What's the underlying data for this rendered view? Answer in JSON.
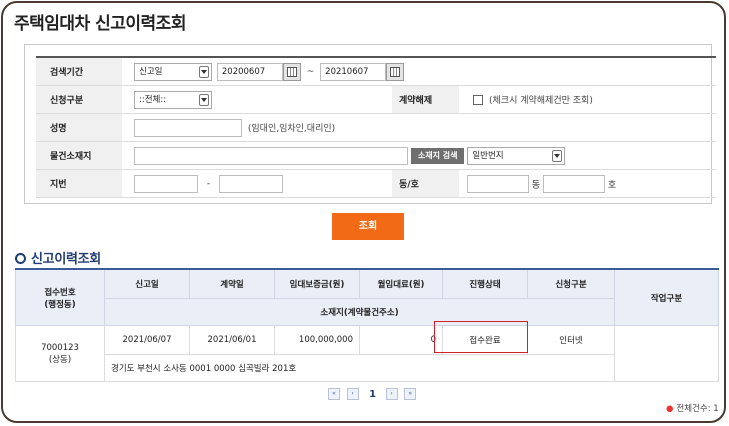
{
  "page_title": "주택임대차 신고이력조회",
  "search": {
    "period_label": "검색기간",
    "date_type_selected": "신고일",
    "date_from": "20200607",
    "date_to": "20210607",
    "tilde": "~",
    "apply_type_label": "신청구분",
    "apply_type_selected": "::전체::",
    "cancel_label": "계약해제",
    "cancel_note": "(체크시 계약해제건만 조회)",
    "name_label": "성명",
    "name_value": "",
    "name_note": "(임대인,임차인,대리인)",
    "address_label": "물건소재지",
    "address_value": "",
    "address_search_button": "소재지 검색",
    "lot_type_selected": "일반번지",
    "lot_label": "지번",
    "lot_main": "",
    "lot_dash": "-",
    "lot_sub": "",
    "dong_ho_label": "동/호",
    "dong_value": "",
    "dong_suffix": "동",
    "ho_value": "",
    "ho_suffix": "호",
    "submit_button": "조회"
  },
  "section_title": "신고이력조회",
  "result": {
    "headers": {
      "receipt_no": "접수번호",
      "receipt_no_sub": "(행정동)",
      "report_date": "신고일",
      "contract_date": "계약일",
      "deposit": "임대보증금(원)",
      "monthly_rent": "월임대료(원)",
      "status": "진행상태",
      "apply_type": "신청구분",
      "work_type": "작업구분",
      "location": "소재지(계약물건주소)"
    },
    "rows": [
      {
        "receipt_no": "7000123",
        "admin_dong": "(상동)",
        "report_date": "2021/06/07",
        "contract_date": "2021/06/01",
        "deposit": "100,000,000",
        "monthly_rent": "0",
        "status": "접수완료",
        "apply_type": "인터넷",
        "work_type": "",
        "location": "경기도 부천시 소사동 0001 0000 심곡빌라 201호"
      }
    ]
  },
  "pagination": {
    "first": "«",
    "prev": "‹",
    "current_page": "1",
    "next": "›",
    "last": "»"
  },
  "total_label": "전체건수: 1",
  "colors": {
    "accent_orange": "#f26a16",
    "section_blue": "#1f3d73",
    "highlight_red": "#d0202a"
  }
}
